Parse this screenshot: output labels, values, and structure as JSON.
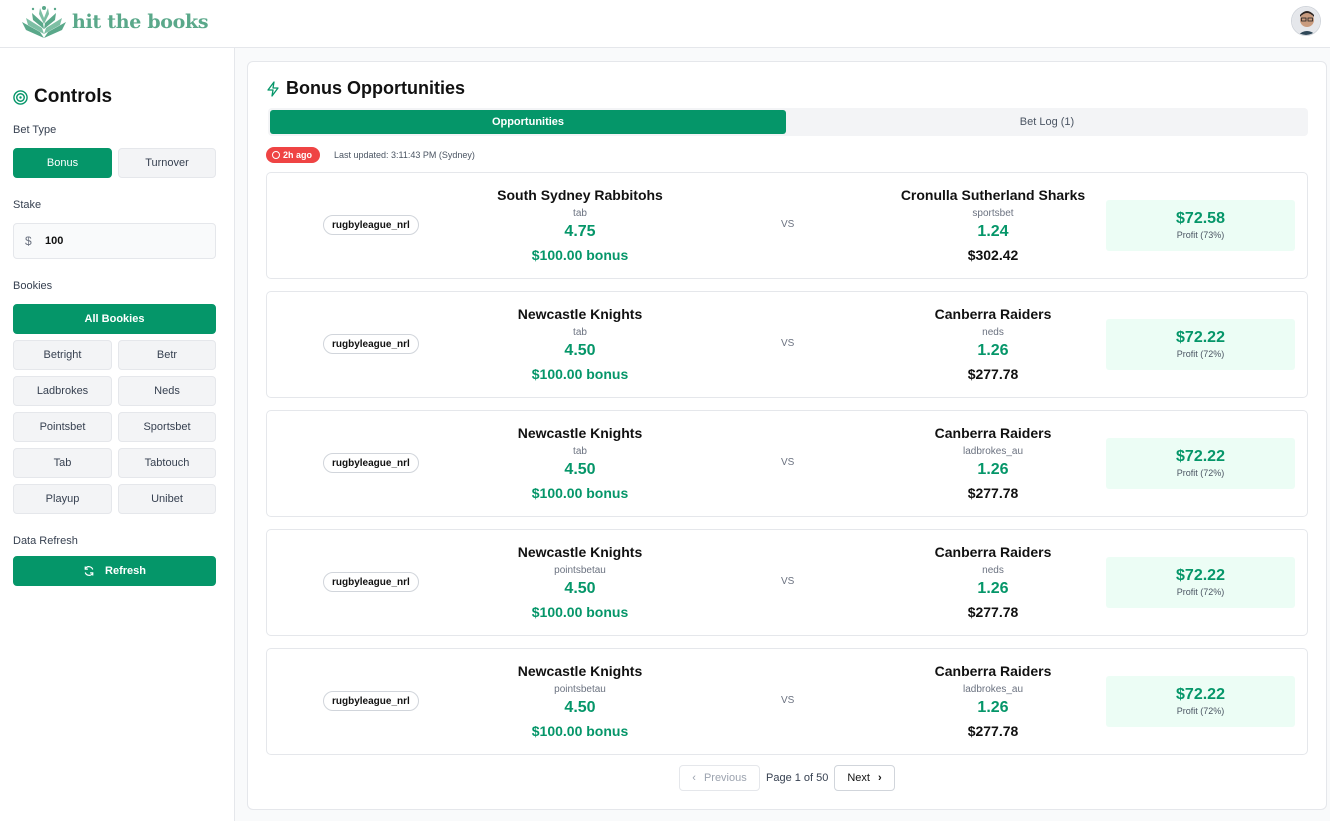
{
  "app": {
    "name": "hit the books"
  },
  "colors": {
    "accent": "#059669",
    "accent_light": "#ecfdf5",
    "stale": "#ef4444"
  },
  "sidebar": {
    "title": "Controls",
    "bet_type_label": "Bet Type",
    "bet_types": [
      "Bonus",
      "Turnover"
    ],
    "selected_bet_type": "Bonus",
    "stake_label": "Stake",
    "stake_currency": "$",
    "stake_value": "100",
    "bookies_label": "Bookies",
    "all_bookies_label": "All Bookies",
    "bookies": [
      "Betright",
      "Betr",
      "Ladbrokes",
      "Neds",
      "Pointsbet",
      "Sportsbet",
      "Tab",
      "Tabtouch",
      "Playup",
      "Unibet"
    ],
    "refresh_section_label": "Data Refresh",
    "refresh_label": "Refresh"
  },
  "main": {
    "title": "Bonus Opportunities",
    "tabs": [
      {
        "label": "Opportunities",
        "active": true
      },
      {
        "label": "Bet Log (1)",
        "active": false
      }
    ],
    "stale_badge": "2h ago",
    "last_updated": "Last updated: 3:11:43 PM (Sydney)",
    "vs_label": "VS",
    "opportunities": [
      {
        "sport": "rugbyleague_nrl",
        "left": {
          "team": "South Sydney Rabbitohs",
          "bookie": "tab",
          "odds": "4.75",
          "amount": "$100.00 bonus"
        },
        "right": {
          "team": "Cronulla Sutherland Sharks",
          "bookie": "sportsbet",
          "odds": "1.24",
          "amount": "$302.42"
        },
        "profit": "$72.58",
        "profit_pct": "Profit (73%)"
      },
      {
        "sport": "rugbyleague_nrl",
        "left": {
          "team": "Newcastle Knights",
          "bookie": "tab",
          "odds": "4.50",
          "amount": "$100.00 bonus"
        },
        "right": {
          "team": "Canberra Raiders",
          "bookie": "neds",
          "odds": "1.26",
          "amount": "$277.78"
        },
        "profit": "$72.22",
        "profit_pct": "Profit (72%)"
      },
      {
        "sport": "rugbyleague_nrl",
        "left": {
          "team": "Newcastle Knights",
          "bookie": "tab",
          "odds": "4.50",
          "amount": "$100.00 bonus"
        },
        "right": {
          "team": "Canberra Raiders",
          "bookie": "ladbrokes_au",
          "odds": "1.26",
          "amount": "$277.78"
        },
        "profit": "$72.22",
        "profit_pct": "Profit (72%)"
      },
      {
        "sport": "rugbyleague_nrl",
        "left": {
          "team": "Newcastle Knights",
          "bookie": "pointsbetau",
          "odds": "4.50",
          "amount": "$100.00 bonus"
        },
        "right": {
          "team": "Canberra Raiders",
          "bookie": "neds",
          "odds": "1.26",
          "amount": "$277.78"
        },
        "profit": "$72.22",
        "profit_pct": "Profit (72%)"
      },
      {
        "sport": "rugbyleague_nrl",
        "left": {
          "team": "Newcastle Knights",
          "bookie": "pointsbetau",
          "odds": "4.50",
          "amount": "$100.00 bonus"
        },
        "right": {
          "team": "Canberra Raiders",
          "bookie": "ladbrokes_au",
          "odds": "1.26",
          "amount": "$277.78"
        },
        "profit": "$72.22",
        "profit_pct": "Profit (72%)"
      }
    ],
    "pagination": {
      "previous": "Previous",
      "info": "Page 1 of 50",
      "next": "Next"
    }
  }
}
